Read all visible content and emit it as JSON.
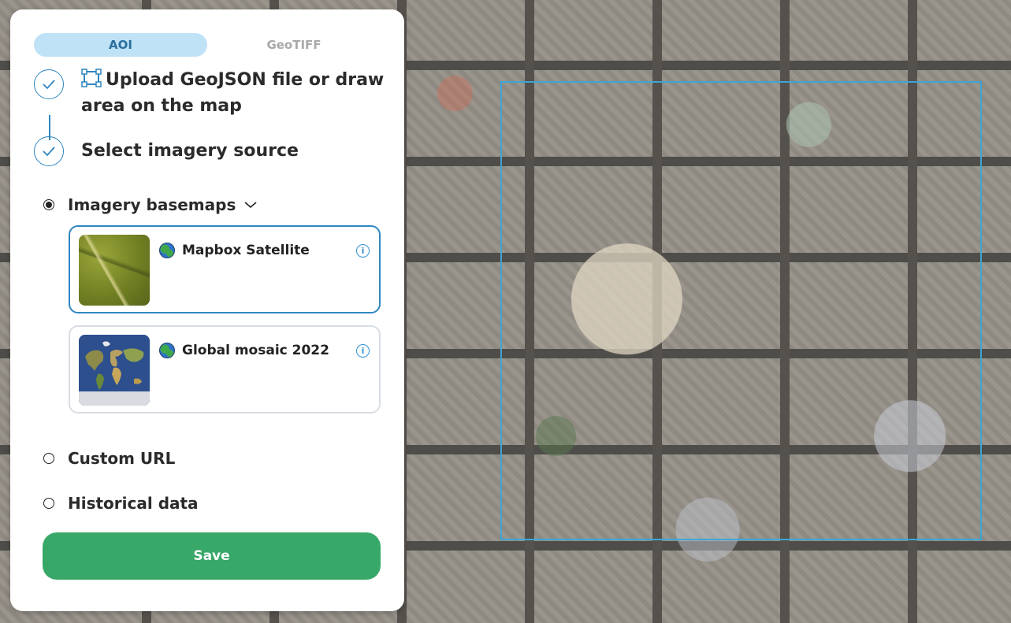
{
  "tabs": [
    {
      "label": "AOI",
      "active": true
    },
    {
      "label": "GeoTIFF",
      "active": false
    }
  ],
  "steps": [
    {
      "text_line1": "Upload GeoJSON file or draw",
      "text_line2": "area on the map",
      "icon": "polygon-draw-icon",
      "completed": true
    },
    {
      "text": "Select imagery source",
      "completed": true
    }
  ],
  "sources": {
    "imagery_basemaps": {
      "label": "Imagery basemaps",
      "selected": true,
      "expanded": true
    },
    "custom_url": {
      "label": "Custom URL",
      "selected": false
    },
    "historical_data": {
      "label": "Historical data",
      "selected": false
    }
  },
  "basemaps": [
    {
      "title": "Mapbox Satellite",
      "selected": true,
      "thumbnail": "satellite-terrain-thumbnail"
    },
    {
      "title": "Global mosaic 2022",
      "selected": false,
      "thumbnail": "world-mosaic-thumbnail"
    }
  ],
  "save_label": "Save",
  "colors": {
    "accent": "#2f86bf",
    "tab_active_bg": "#bfe2f6",
    "save_button": "#38a868",
    "aoi_outline": "#3aa6d6"
  }
}
